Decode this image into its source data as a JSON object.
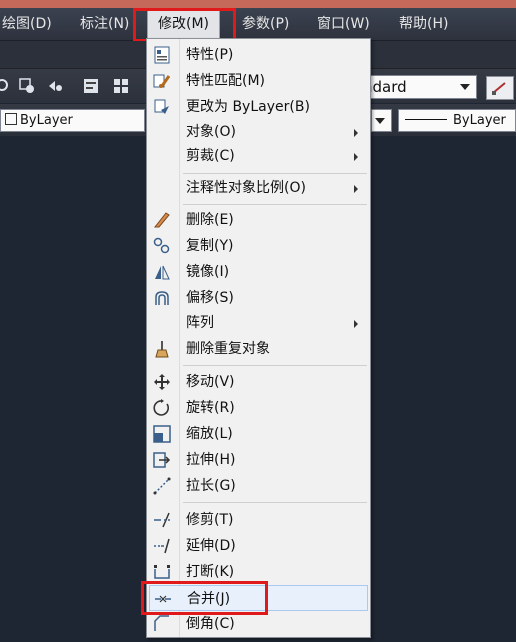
{
  "menubar": {
    "items": [
      {
        "id": "draw",
        "label": "绘图(D)"
      },
      {
        "id": "dimension",
        "label": "标注(N)"
      },
      {
        "id": "modify",
        "label": "修改(M)"
      },
      {
        "id": "param",
        "label": "参数(P)"
      },
      {
        "id": "window",
        "label": "窗口(W)"
      },
      {
        "id": "help",
        "label": "帮助(H)"
      }
    ]
  },
  "toolbar": {
    "style_combo": "ndard",
    "layer_combo": "ByLayer",
    "linetype_combo": "ByLayer"
  },
  "modify_menu": {
    "items": [
      {
        "label": "特性(P)",
        "icon": "properties-icon"
      },
      {
        "label": "特性匹配(M)",
        "icon": "match-properties-icon"
      },
      {
        "label": "更改为 ByLayer(B)",
        "icon": "set-bylayer-icon"
      },
      {
        "label": "对象(O)",
        "submenu": true
      },
      {
        "label": "剪裁(C)",
        "submenu": true
      },
      {
        "label": "注释性对象比例(O)",
        "submenu": true
      },
      {
        "label": "删除(E)",
        "icon": "erase-icon"
      },
      {
        "label": "复制(Y)",
        "icon": "copy-icon"
      },
      {
        "label": "镜像(I)",
        "icon": "mirror-icon"
      },
      {
        "label": "偏移(S)",
        "icon": "offset-icon"
      },
      {
        "label": "阵列",
        "submenu": true
      },
      {
        "label": "删除重复对象",
        "icon": "overkill-icon"
      },
      {
        "label": "移动(V)",
        "icon": "move-icon"
      },
      {
        "label": "旋转(R)",
        "icon": "rotate-icon"
      },
      {
        "label": "缩放(L)",
        "icon": "scale-icon"
      },
      {
        "label": "拉伸(H)",
        "icon": "stretch-icon"
      },
      {
        "label": "拉长(G)",
        "icon": "lengthen-icon"
      },
      {
        "label": "修剪(T)",
        "icon": "trim-icon"
      },
      {
        "label": "延伸(D)",
        "icon": "extend-icon"
      },
      {
        "label": "打断(K)",
        "icon": "break-icon"
      },
      {
        "label": "合并(J)",
        "icon": "join-icon",
        "highlighted": true
      },
      {
        "label": "倒角(C)",
        "icon": "chamfer-icon"
      }
    ]
  },
  "colors": {
    "highlight_box": "#e01a1a",
    "menubar_bg": "#2d323d",
    "canvas_bg": "#1f2633"
  }
}
